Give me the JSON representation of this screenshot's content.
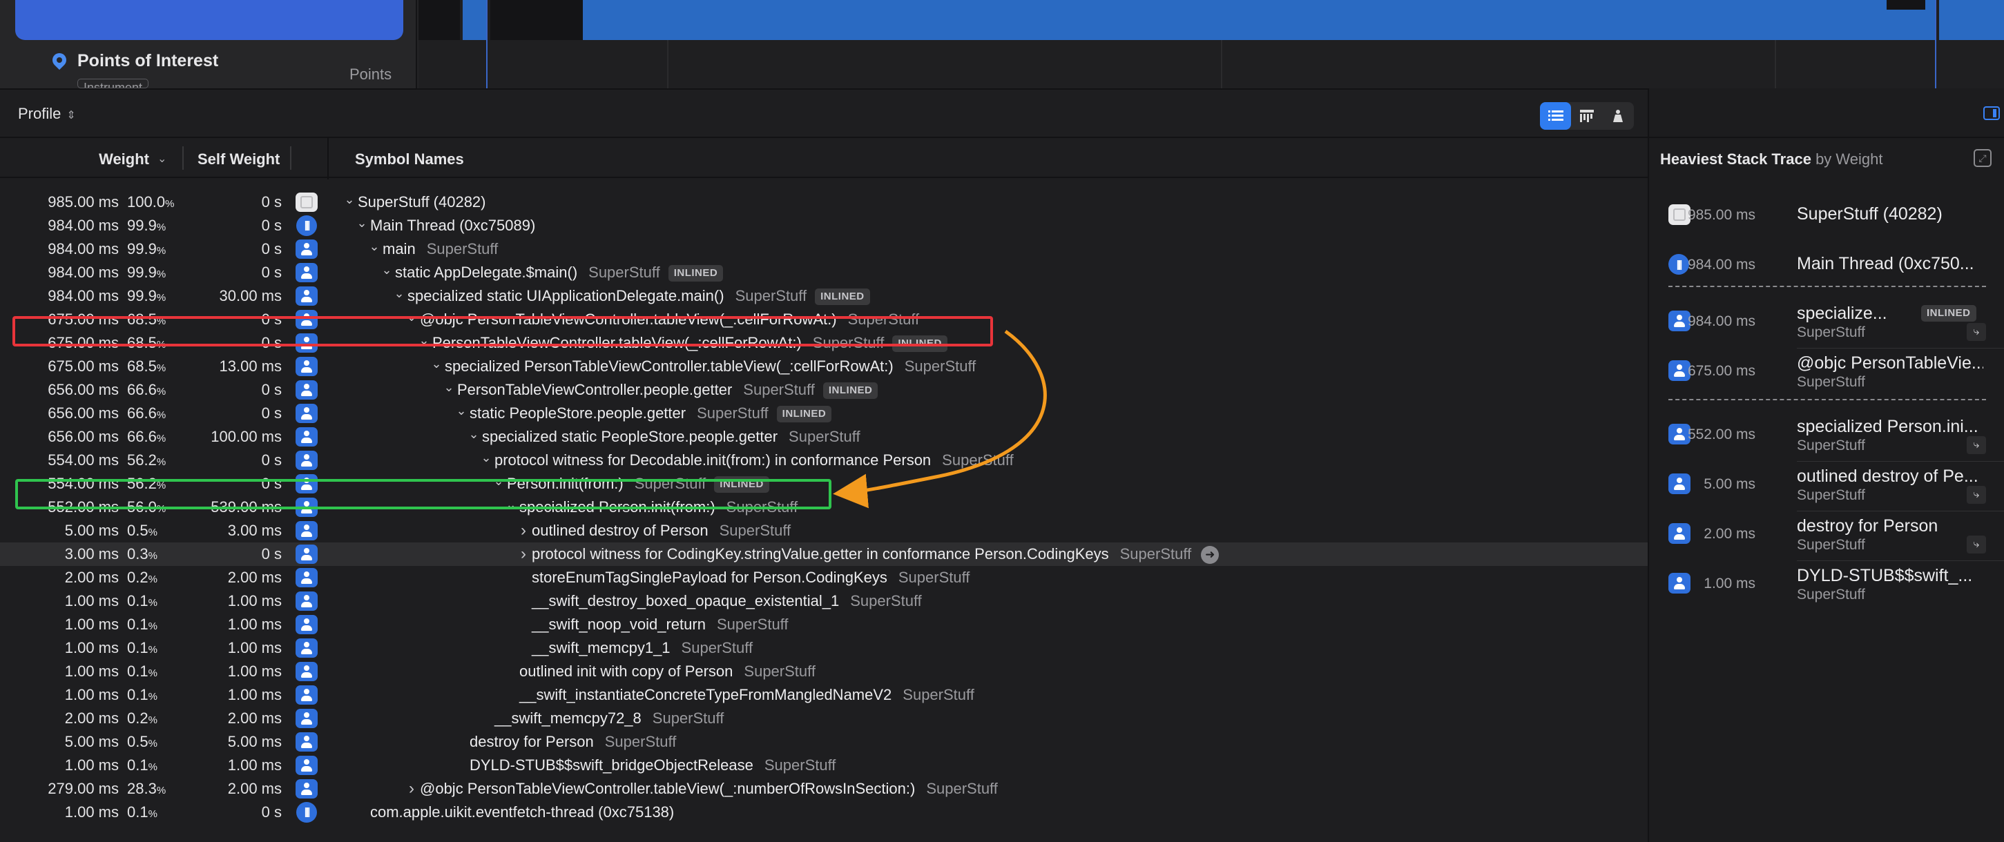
{
  "top": {
    "track_title": "Points of Interest",
    "track_subtitle": "Instrument",
    "track_label": "Points"
  },
  "toolbar": {
    "profile_label": "Profile",
    "profile_chevron": "⇕",
    "view_buttons": [
      "call-tree-icon",
      "flame-graph-icon",
      "heaviest-icon"
    ]
  },
  "columns": {
    "weight": "Weight",
    "self_weight": "Self Weight",
    "symbol_names": "Symbol Names"
  },
  "rows": [
    {
      "w": "985.00 ms",
      "p": "100.0",
      "s": "0 s",
      "icon": "process",
      "sym": "SuperStuff (40282)",
      "lib": "",
      "badge": "",
      "disc": "open"
    },
    {
      "w": "984.00 ms",
      "p": "99.9",
      "s": "0 s",
      "icon": "thread",
      "sym": "Main Thread  (0xc75089)",
      "lib": "",
      "badge": "",
      "disc": "open"
    },
    {
      "w": "984.00 ms",
      "p": "99.9",
      "s": "0 s",
      "icon": "user",
      "sym": "main",
      "lib": "SuperStuff",
      "badge": "",
      "disc": "open"
    },
    {
      "w": "984.00 ms",
      "p": "99.9",
      "s": "0 s",
      "icon": "user",
      "sym": "static AppDelegate.$main()",
      "lib": "SuperStuff",
      "badge": "INLINED",
      "disc": "open"
    },
    {
      "w": "984.00 ms",
      "p": "99.9",
      "s": "30.00 ms",
      "icon": "user",
      "sym": "specialized static UIApplicationDelegate.main()",
      "lib": "SuperStuff",
      "badge": "INLINED",
      "disc": "open"
    },
    {
      "w": "675.00 ms",
      "p": "68.5",
      "s": "0 s",
      "icon": "user",
      "sym": "@objc PersonTableViewController.tableView(_:cellForRowAt:)",
      "lib": "SuperStuff",
      "badge": "",
      "disc": "open"
    },
    {
      "w": "675.00 ms",
      "p": "68.5",
      "s": "0 s",
      "icon": "user",
      "sym": "PersonTableViewController.tableView(_:cellForRowAt:)",
      "lib": "SuperStuff",
      "badge": "INLINED",
      "disc": "open"
    },
    {
      "w": "675.00 ms",
      "p": "68.5",
      "s": "13.00 ms",
      "icon": "user",
      "sym": "specialized PersonTableViewController.tableView(_:cellForRowAt:)",
      "lib": "SuperStuff",
      "badge": "",
      "disc": "open"
    },
    {
      "w": "656.00 ms",
      "p": "66.6",
      "s": "0 s",
      "icon": "user",
      "sym": "PersonTableViewController.people.getter",
      "lib": "SuperStuff",
      "badge": "INLINED",
      "disc": "open"
    },
    {
      "w": "656.00 ms",
      "p": "66.6",
      "s": "0 s",
      "icon": "user",
      "sym": "static PeopleStore.people.getter",
      "lib": "SuperStuff",
      "badge": "INLINED",
      "disc": "open"
    },
    {
      "w": "656.00 ms",
      "p": "66.6",
      "s": "100.00 ms",
      "icon": "user",
      "sym": "specialized static PeopleStore.people.getter",
      "lib": "SuperStuff",
      "badge": "",
      "disc": "open"
    },
    {
      "w": "554.00 ms",
      "p": "56.2",
      "s": "0 s",
      "icon": "user",
      "sym": "protocol witness for Decodable.init(from:) in conformance Person",
      "lib": "SuperStuff",
      "badge": "",
      "disc": "open"
    },
    {
      "w": "554.00 ms",
      "p": "56.2",
      "s": "0 s",
      "icon": "user",
      "sym": "Person.init(from:)",
      "lib": "SuperStuff",
      "badge": "INLINED",
      "disc": "open"
    },
    {
      "w": "552.00 ms",
      "p": "56.0",
      "s": "539.00 ms",
      "icon": "user",
      "sym": "specialized Person.init(from:)",
      "lib": "SuperStuff",
      "badge": "",
      "disc": "open"
    },
    {
      "w": "5.00 ms",
      "p": "0.5",
      "s": "3.00 ms",
      "icon": "user",
      "sym": "outlined destroy of Person",
      "lib": "SuperStuff",
      "badge": "",
      "disc": "closed"
    },
    {
      "w": "3.00 ms",
      "p": "0.3",
      "s": "0 s",
      "icon": "user",
      "sym": "protocol witness for CodingKey.stringValue.getter in conformance Person.CodingKeys",
      "lib": "SuperStuff",
      "badge": "",
      "disc": "closed",
      "focus": "➜"
    },
    {
      "w": "2.00 ms",
      "p": "0.2",
      "s": "2.00 ms",
      "icon": "user",
      "sym": "storeEnumTagSinglePayload for Person.CodingKeys",
      "lib": "SuperStuff",
      "badge": "",
      "disc": "none"
    },
    {
      "w": "1.00 ms",
      "p": "0.1",
      "s": "1.00 ms",
      "icon": "user",
      "sym": "__swift_destroy_boxed_opaque_existential_1",
      "lib": "SuperStuff",
      "badge": "",
      "disc": "none"
    },
    {
      "w": "1.00 ms",
      "p": "0.1",
      "s": "1.00 ms",
      "icon": "user",
      "sym": "__swift_noop_void_return",
      "lib": "SuperStuff",
      "badge": "",
      "disc": "none"
    },
    {
      "w": "1.00 ms",
      "p": "0.1",
      "s": "1.00 ms",
      "icon": "user",
      "sym": "__swift_memcpy1_1",
      "lib": "SuperStuff",
      "badge": "",
      "disc": "none"
    },
    {
      "w": "1.00 ms",
      "p": "0.1",
      "s": "1.00 ms",
      "icon": "user",
      "sym": "outlined init with copy of Person",
      "lib": "SuperStuff",
      "badge": "",
      "disc": "none"
    },
    {
      "w": "1.00 ms",
      "p": "0.1",
      "s": "1.00 ms",
      "icon": "user",
      "sym": "__swift_instantiateConcreteTypeFromMangledNameV2",
      "lib": "SuperStuff",
      "badge": "",
      "disc": "none"
    },
    {
      "w": "2.00 ms",
      "p": "0.2",
      "s": "2.00 ms",
      "icon": "user",
      "sym": "__swift_memcpy72_8",
      "lib": "SuperStuff",
      "badge": "",
      "disc": "none"
    },
    {
      "w": "5.00 ms",
      "p": "0.5",
      "s": "5.00 ms",
      "icon": "user",
      "sym": "destroy for Person",
      "lib": "SuperStuff",
      "badge": "",
      "disc": "none"
    },
    {
      "w": "1.00 ms",
      "p": "0.1",
      "s": "1.00 ms",
      "icon": "user",
      "sym": "DYLD-STUB$$swift_bridgeObjectRelease",
      "lib": "SuperStuff",
      "badge": "",
      "disc": "none"
    },
    {
      "w": "279.00 ms",
      "p": "28.3",
      "s": "2.00 ms",
      "icon": "user",
      "sym": "@objc PersonTableViewController.tableView(_:numberOfRowsInSection:)",
      "lib": "SuperStuff",
      "badge": "",
      "disc": "closed"
    },
    {
      "w": "1.00 ms",
      "p": "0.1",
      "s": "0 s",
      "icon": "thread",
      "sym": "com.apple.uikit.eventfetch-thread  (0xc75138)",
      "lib": "",
      "badge": "",
      "disc": "none"
    }
  ],
  "heaviest": {
    "title": "Heaviest Stack Trace",
    "by": "by Weight",
    "items": [
      {
        "icon": "process",
        "ms": "985.00 ms",
        "name": "SuperStuff (40282)",
        "lib": "",
        "badge": "",
        "mini": false
      },
      {
        "icon": "thread",
        "ms": "984.00 ms",
        "name": "Main Thread  (0xc750...",
        "lib": "",
        "badge": "",
        "mini": false
      },
      {
        "icon": "user",
        "ms": "984.00 ms",
        "name": "specialize...",
        "lib": "SuperStuff",
        "badge": "INLINED",
        "mini": true
      },
      {
        "icon": "user",
        "ms": "675.00 ms",
        "name": "@objc PersonTableVie...",
        "lib": "SuperStuff",
        "badge": "",
        "mini": false
      },
      {
        "icon": "user",
        "ms": "552.00 ms",
        "name": "specialized Person.ini...",
        "lib": "SuperStuff",
        "badge": "",
        "mini": true
      },
      {
        "icon": "user",
        "ms": "5.00 ms",
        "name": "outlined destroy of Pe...",
        "lib": "SuperStuff",
        "badge": "",
        "mini": true
      },
      {
        "icon": "user",
        "ms": "2.00 ms",
        "name": "destroy for Person",
        "lib": "SuperStuff",
        "badge": "",
        "mini": true
      },
      {
        "icon": "user",
        "ms": "1.00 ms",
        "name": "DYLD-STUB$$swift_...",
        "lib": "SuperStuff",
        "badge": "",
        "mini": false
      }
    ]
  },
  "colors": {
    "highlight_red": "#e8343a",
    "highlight_green": "#2fc44e",
    "arrow_orange": "#f39a1e",
    "accent_blue": "#2f7cf0"
  }
}
